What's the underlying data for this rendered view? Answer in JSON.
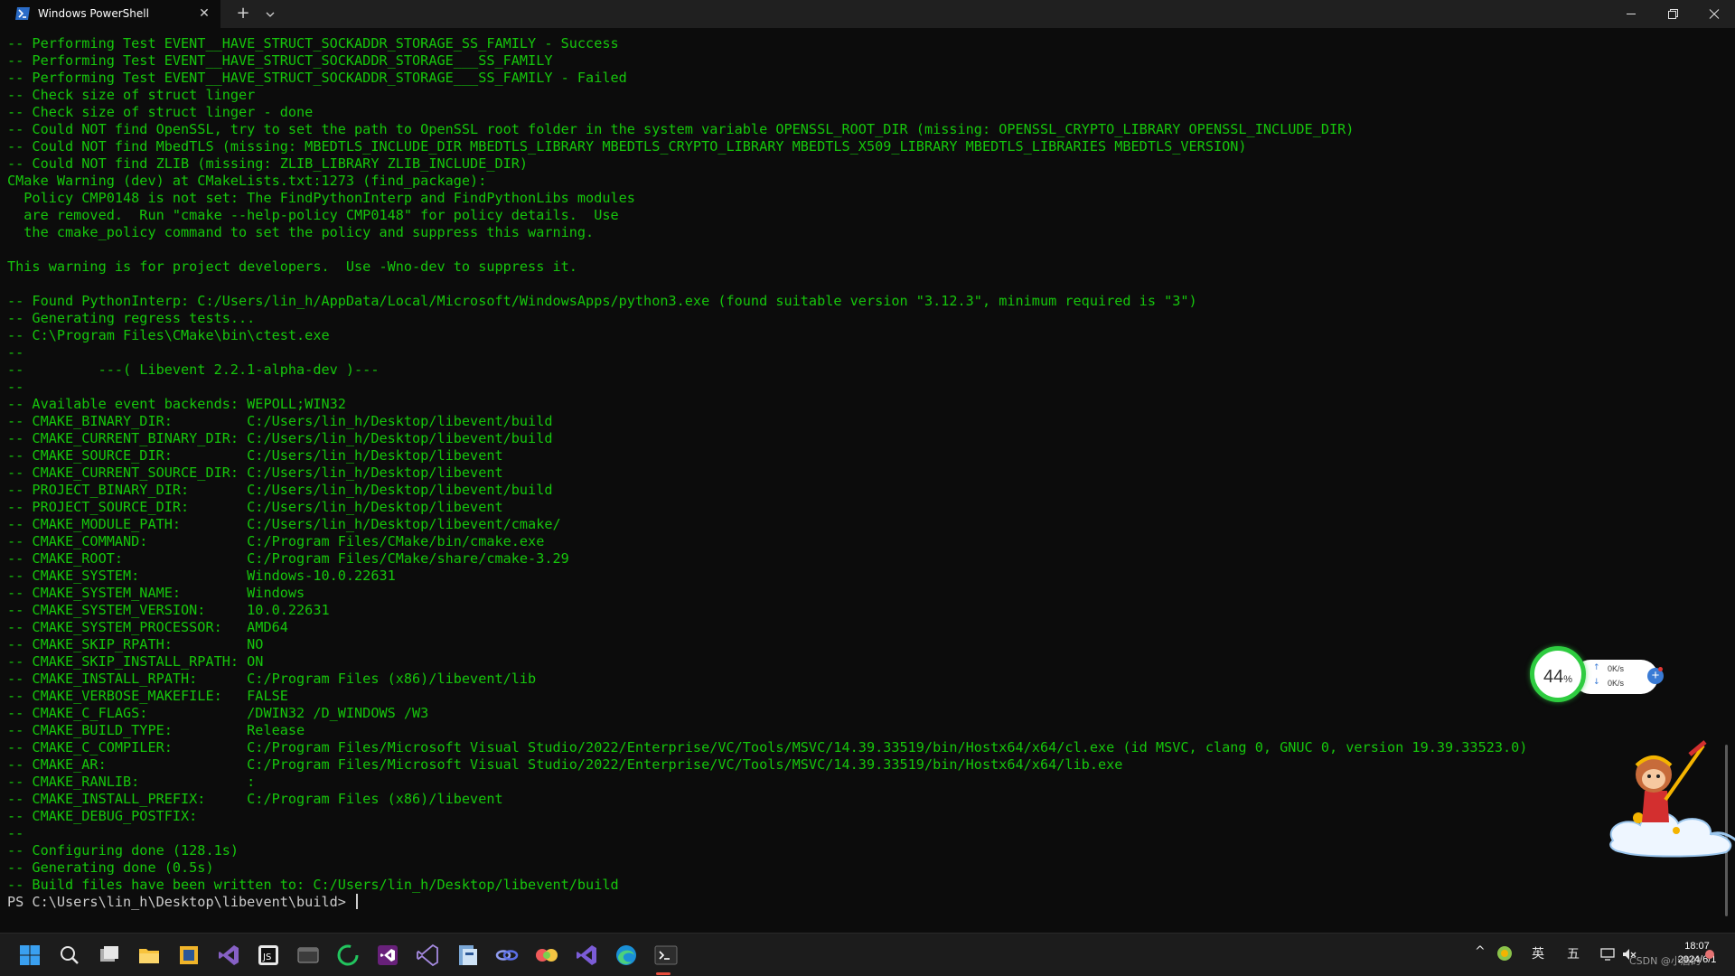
{
  "tab": {
    "title": "Windows PowerShell",
    "close": "✕"
  },
  "toolbar": {
    "new_tab": "+"
  },
  "terminal": {
    "lines": [
      "-- Performing Test EVENT__HAVE_STRUCT_SOCKADDR_STORAGE_SS_FAMILY - Success",
      "-- Performing Test EVENT__HAVE_STRUCT_SOCKADDR_STORAGE___SS_FAMILY",
      "-- Performing Test EVENT__HAVE_STRUCT_SOCKADDR_STORAGE___SS_FAMILY - Failed",
      "-- Check size of struct linger",
      "-- Check size of struct linger - done",
      "-- Could NOT find OpenSSL, try to set the path to OpenSSL root folder in the system variable OPENSSL_ROOT_DIR (missing: OPENSSL_CRYPTO_LIBRARY OPENSSL_INCLUDE_DIR)",
      "-- Could NOT find MbedTLS (missing: MBEDTLS_INCLUDE_DIR MBEDTLS_LIBRARY MBEDTLS_CRYPTO_LIBRARY MBEDTLS_X509_LIBRARY MBEDTLS_LIBRARIES MBEDTLS_VERSION)",
      "-- Could NOT find ZLIB (missing: ZLIB_LIBRARY ZLIB_INCLUDE_DIR)",
      "CMake Warning (dev) at CMakeLists.txt:1273 (find_package):",
      "  Policy CMP0148 is not set: The FindPythonInterp and FindPythonLibs modules",
      "  are removed.  Run \"cmake --help-policy CMP0148\" for policy details.  Use",
      "  the cmake_policy command to set the policy and suppress this warning.",
      "",
      "This warning is for project developers.  Use -Wno-dev to suppress it.",
      "",
      "-- Found PythonInterp: C:/Users/lin_h/AppData/Local/Microsoft/WindowsApps/python3.exe (found suitable version \"3.12.3\", minimum required is \"3\")",
      "-- Generating regress tests...",
      "-- C:\\Program Files\\CMake\\bin\\ctest.exe",
      "--",
      "--         ---( Libevent 2.2.1-alpha-dev )---",
      "--",
      "-- Available event backends: WEPOLL;WIN32",
      "-- CMAKE_BINARY_DIR:         C:/Users/lin_h/Desktop/libevent/build",
      "-- CMAKE_CURRENT_BINARY_DIR: C:/Users/lin_h/Desktop/libevent/build",
      "-- CMAKE_SOURCE_DIR:         C:/Users/lin_h/Desktop/libevent",
      "-- CMAKE_CURRENT_SOURCE_DIR: C:/Users/lin_h/Desktop/libevent",
      "-- PROJECT_BINARY_DIR:       C:/Users/lin_h/Desktop/libevent/build",
      "-- PROJECT_SOURCE_DIR:       C:/Users/lin_h/Desktop/libevent",
      "-- CMAKE_MODULE_PATH:        C:/Users/lin_h/Desktop/libevent/cmake/",
      "-- CMAKE_COMMAND:            C:/Program Files/CMake/bin/cmake.exe",
      "-- CMAKE_ROOT:               C:/Program Files/CMake/share/cmake-3.29",
      "-- CMAKE_SYSTEM:             Windows-10.0.22631",
      "-- CMAKE_SYSTEM_NAME:        Windows",
      "-- CMAKE_SYSTEM_VERSION:     10.0.22631",
      "-- CMAKE_SYSTEM_PROCESSOR:   AMD64",
      "-- CMAKE_SKIP_RPATH:         NO",
      "-- CMAKE_SKIP_INSTALL_RPATH: ON",
      "-- CMAKE_INSTALL_RPATH:      C:/Program Files (x86)/libevent/lib",
      "-- CMAKE_VERBOSE_MAKEFILE:   FALSE",
      "-- CMAKE_C_FLAGS:            /DWIN32 /D_WINDOWS /W3",
      "-- CMAKE_BUILD_TYPE:         Release",
      "-- CMAKE_C_COMPILER:         C:/Program Files/Microsoft Visual Studio/2022/Enterprise/VC/Tools/MSVC/14.39.33519/bin/Hostx64/x64/cl.exe (id MSVC, clang 0, GNUC 0, version 19.39.33523.0)",
      "-- CMAKE_AR:                 C:/Program Files/Microsoft Visual Studio/2022/Enterprise/VC/Tools/MSVC/14.39.33519/bin/Hostx64/x64/lib.exe",
      "-- CMAKE_RANLIB:             :",
      "-- CMAKE_INSTALL_PREFIX:     C:/Program Files (x86)/libevent",
      "-- CMAKE_DEBUG_POSTFIX:",
      "--",
      "-- Configuring done (128.1s)",
      "-- Generating done (0.5s)",
      "-- Build files have been written to: C:/Users/lin_h/Desktop/libevent/build"
    ],
    "prompt": "PS C:\\Users\\lin_h\\Desktop\\libevent\\build> ",
    "colors": {
      "output": "#16c60c",
      "prompt": "#cccccc",
      "background": "#0c0c0c"
    }
  },
  "net_widget": {
    "percent": "44",
    "percent_sign": "%",
    "upload": "0K/s",
    "download": "0K/s"
  },
  "taskbar": {
    "icons": [
      "windows-start-icon",
      "search-icon",
      "task-view-icon",
      "file-explorer-icon",
      "app-icon",
      "visual-studio-icon",
      "jetbrains-icon",
      "terminal-window-icon",
      "green-ring-icon",
      "visual-studio-purple-icon",
      "visual-studio-outline-icon",
      "app-map-icon",
      "link-icon",
      "colorful-app-icon",
      "vscode-icon",
      "edge-icon",
      "terminal-icon"
    ],
    "tray": {
      "chevron": "^",
      "ime_lang": "英",
      "ime_mode": "五"
    },
    "clock": {
      "time": "18:07",
      "date": "2024/6/1"
    },
    "watermark": "CSDN @小唐的"
  }
}
